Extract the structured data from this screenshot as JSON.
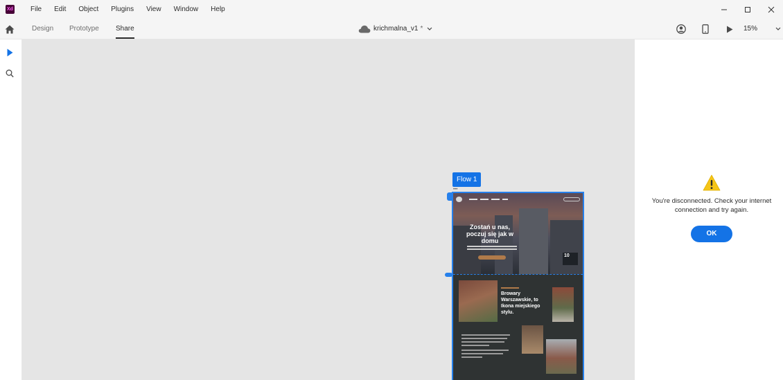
{
  "menubar": {
    "app_icon": "adobe-xd-logo",
    "app_badge_text": "Xd",
    "items": [
      "File",
      "Edit",
      "Object",
      "Plugins",
      "View",
      "Window",
      "Help"
    ]
  },
  "window_controls": {
    "icons": [
      "minimize-icon",
      "maximize-icon",
      "close-icon"
    ]
  },
  "modebar": {
    "tabs": [
      {
        "label": "Design",
        "active": false
      },
      {
        "label": "Prototype",
        "active": false
      },
      {
        "label": "Share",
        "active": true
      }
    ],
    "document": {
      "name": "krichmalna_v1",
      "modified_marker": "*",
      "icon": "cloud-icon"
    },
    "zoom": "15%",
    "right_icons": [
      "user-icon",
      "mobile-preview-icon",
      "play-icon"
    ]
  },
  "toolbar": {
    "tools": [
      "select-tool-icon",
      "zoom-tool-icon"
    ]
  },
  "canvas": {
    "flow_label": "Flow 1",
    "artboard": {
      "hero_title": "Zostań u nas, poczuj się jak w domu",
      "hero_badge": "10",
      "section_title": "Browary Warszawskie, to Ikona miejskiego stylu."
    }
  },
  "panel": {
    "icon": "warning-icon",
    "warning_color": "#f5c518",
    "message": "You're disconnected. Check your internet connection and try again.",
    "ok_label": "OK",
    "accent_color": "#1473e6"
  }
}
